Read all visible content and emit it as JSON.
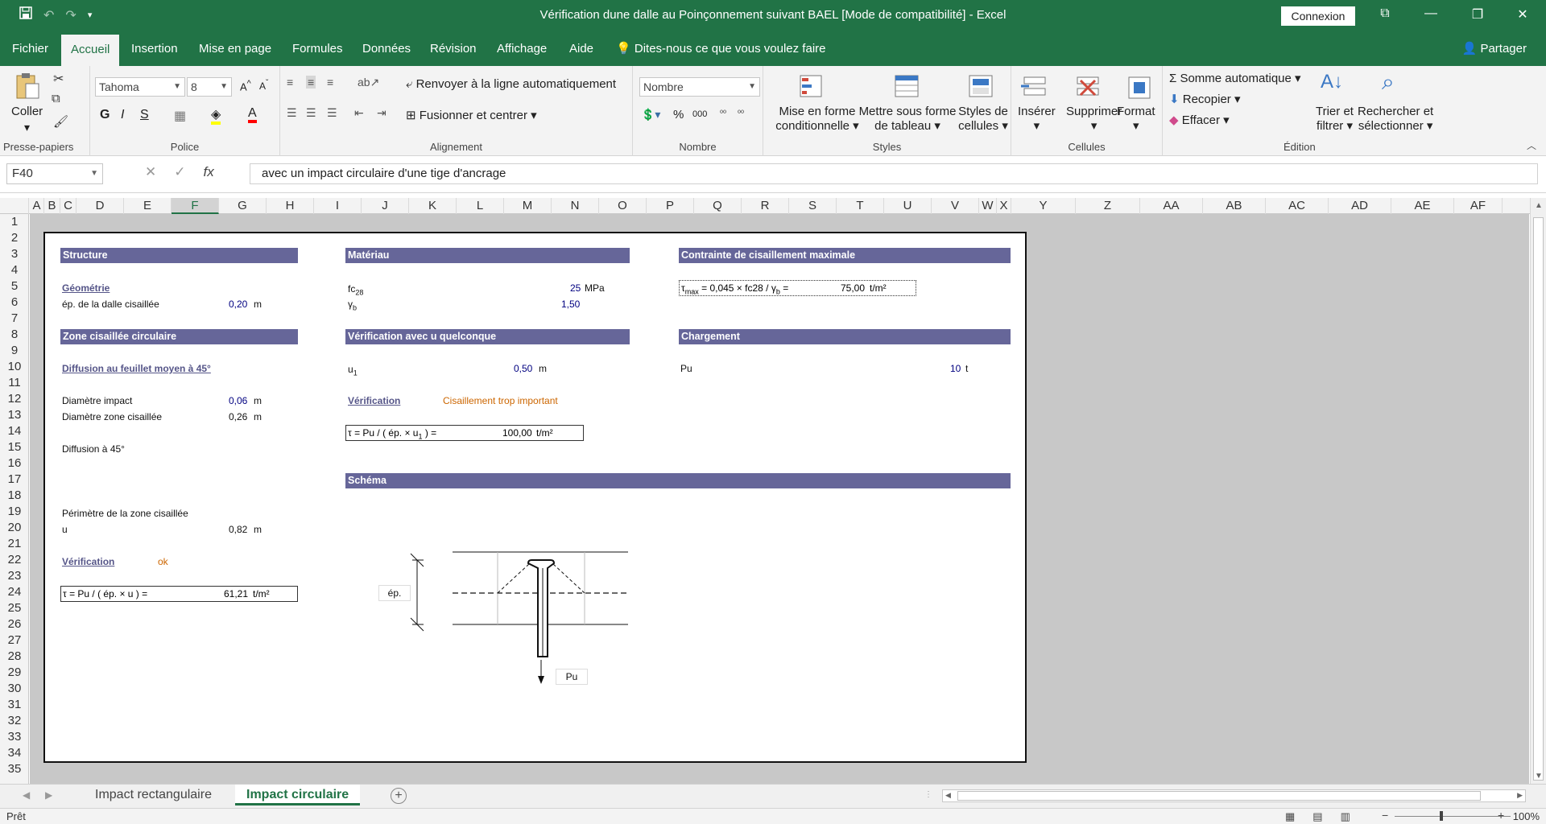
{
  "window": {
    "title": "Vérification dune dalle au Poinçonnement suivant BAEL  [Mode de compatibilité]  -  Excel",
    "connexion": "Connexion"
  },
  "menu": {
    "tabs": [
      "Fichier",
      "Accueil",
      "Insertion",
      "Mise en page",
      "Formules",
      "Données",
      "Révision",
      "Affichage",
      "Aide"
    ],
    "tell_me": "Dites-nous ce que vous voulez faire",
    "share": "Partager"
  },
  "ribbon": {
    "clipboard": {
      "paste": "Coller",
      "label": "Presse-papiers"
    },
    "font": {
      "name": "Tahoma",
      "size": "8",
      "bold": "G",
      "italic": "I",
      "underline": "S",
      "label": "Police"
    },
    "alignment": {
      "wrap": "Renvoyer à la ligne automatiquement",
      "merge": "Fusionner et centrer",
      "label": "Alignement"
    },
    "number": {
      "format": "Nombre",
      "label": "Nombre"
    },
    "styles": {
      "cond": "Mise en forme",
      "cond2": "conditionnelle",
      "table": "Mettre sous forme",
      "table2": "de tableau",
      "cell": "Styles de",
      "cell2": "cellules",
      "label": "Styles"
    },
    "cells": {
      "insert": "Insérer",
      "delete": "Supprimer",
      "format": "Format",
      "label": "Cellules"
    },
    "editing": {
      "autosum": "Somme automatique",
      "fill": "Recopier",
      "clear": "Effacer",
      "sort": "Trier et",
      "sort2": "filtrer",
      "find": "Rechercher et",
      "find2": "sélectionner",
      "label": "Édition"
    }
  },
  "formula_bar": {
    "name_box": "F40",
    "content": "avec un impact circulaire d'une tige d'ancrage"
  },
  "columns": [
    "A",
    "B",
    "C",
    "D",
    "E",
    "F",
    "G",
    "H",
    "I",
    "J",
    "K",
    "L",
    "M",
    "N",
    "O",
    "P",
    "Q",
    "R",
    "S",
    "T",
    "U",
    "V",
    "W",
    "X",
    "Y",
    "Z",
    "AA",
    "AB",
    "AC",
    "AD",
    "AE",
    "AF"
  ],
  "rows": [
    "1",
    "2",
    "3",
    "4",
    "5",
    "6",
    "7",
    "8",
    "9",
    "10",
    "11",
    "12",
    "13",
    "14",
    "15",
    "16",
    "17",
    "18",
    "19",
    "20",
    "21",
    "22",
    "23",
    "24",
    "25",
    "26",
    "27",
    "28",
    "29",
    "30",
    "31",
    "32",
    "33",
    "34",
    "35"
  ],
  "sheet": {
    "structure": "Structure",
    "geometrie": "Géométrie",
    "ep_label": "ép. de la dalle cisaillée",
    "ep_value": "0,20",
    "ep_unit": "m",
    "zone": "Zone cisaillée circulaire",
    "diffusion": "Diffusion au feuillet moyen à 45°",
    "diam_impact_label": "Diamètre impact",
    "diam_impact_value": "0,06",
    "diam_impact_unit": "m",
    "diam_zone_label": "Diamètre zone cisaillée",
    "diam_zone_value": "0,26",
    "diam_zone_unit": "m",
    "diffusion45": "Diffusion à 45°",
    "perimetre_label": "Périmètre de la zone cisaillée",
    "u_label": "u",
    "u_value": "0,82",
    "u_unit": "m",
    "verif1_label": "Vérification",
    "verif1_value": "ok",
    "tau1_formula": "τ = Pu / ( ép. × u ) =",
    "tau1_value": "61,21",
    "tau1_unit": "t/m²",
    "materiau": "Matériau",
    "fc_label": "fc",
    "fc_sub": "28",
    "fc_value": "25",
    "fc_unit": "MPa",
    "gamma_label": "γ",
    "gamma_sub": "b",
    "gamma_value": "1,50",
    "verif_u": "Vérification avec u quelconque",
    "u1_label": "u",
    "u1_sub": "1",
    "u1_value": "0,50",
    "u1_unit": "m",
    "verif2_label": "Vérification",
    "verif2_value": "Cisaillement trop important",
    "tau2_formula_pre": "τ = Pu / ( ép. × u",
    "tau2_formula_sub": "1",
    "tau2_formula_post": " ) =",
    "tau2_value": "100,00",
    "tau2_unit": "t/m²",
    "schema": "Schéma",
    "schema_ep": "ép.",
    "schema_pu": "Pu",
    "contrainte": "Contrainte de cisaillement maximale",
    "tau_max_pre": "τ",
    "tau_max_sub": "max",
    "tau_max_formula": " = 0,045 × fc28 / γ",
    "tau_max_sub2": "b",
    "tau_max_eq": " =",
    "tau_max_value": "75,00",
    "tau_max_unit": "t/m²",
    "chargement": "Chargement",
    "pu_label": "Pu",
    "pu_value": "10",
    "pu_unit": "t"
  },
  "tabs": {
    "sheet1": "Impact rectangulaire",
    "sheet2": "Impact circulaire"
  },
  "status": {
    "ready": "Prêt",
    "zoom": "100%"
  }
}
